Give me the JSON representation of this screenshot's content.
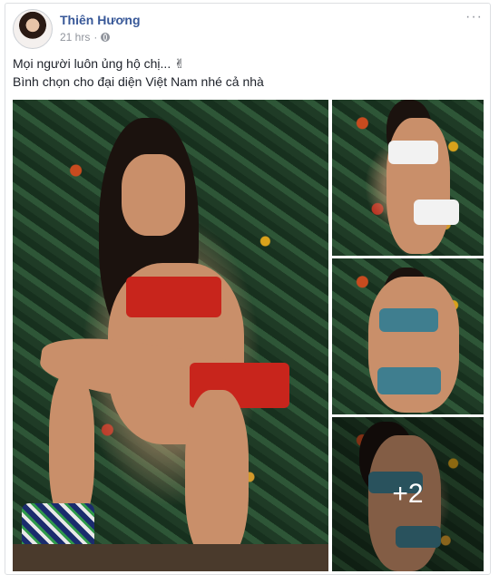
{
  "post": {
    "author": "Thiên Hương",
    "time": "21 hrs",
    "privacy_icon": "globe-icon",
    "more_icon": "ellipsis-icon",
    "more_label": "···",
    "text_lines": [
      "Mọi người luôn ủng hộ chị... ✌",
      "Bình chọn cho đại diện Việt Nam nhé cả nhà"
    ],
    "photos": {
      "count_more_label": "+2"
    }
  },
  "colors": {
    "author_link": "#385898",
    "meta_gray": "#90949c",
    "body_text": "#1d2129"
  }
}
